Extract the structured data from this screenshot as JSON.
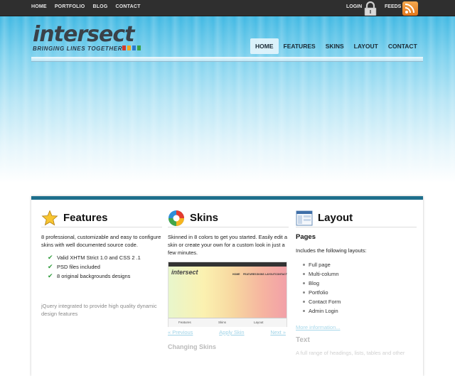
{
  "topbar": {
    "links": [
      "HOME",
      "PORTFOLIO",
      "BLOG",
      "CONTACT"
    ],
    "login": "LOGIN",
    "feeds": "FEEDS",
    "icons": {
      "login": "lock-icon",
      "feeds": "rss-icon"
    }
  },
  "header": {
    "logo": "intersect",
    "tagline": "BRINGING LINES TOGETHER",
    "nav": [
      "HOME",
      "FEATURES",
      "SKINS",
      "LAYOUT",
      "CONTACT"
    ],
    "active_nav": "HOME"
  },
  "features": {
    "title": "Features",
    "icon": "star-icon",
    "intro": "8 professional, customizable and easy to configure skins with well documented source code.",
    "checks": [
      "Valid XHTM Strict 1.0 and CSS 2 .1",
      "PSD files included",
      "8 original backgrounds designs"
    ],
    "extra": "jQuery integrated to provide high quality dynamic design features"
  },
  "skins": {
    "title": "Skins",
    "icon": "palette-icon",
    "intro": "Skinned in 8 colors to get you started. Easily edit a skin or create your own for a custom look in just a few minutes.",
    "thumb_logo": "intersect",
    "thumb_nav": [
      "HOME",
      "FEATURES",
      "SKINS",
      "LAYOUT",
      "CONTACT"
    ],
    "thumb_footer": [
      "Features",
      "Skins",
      "Layout"
    ],
    "prev": "« Previous",
    "apply": "Apply Skin",
    "next": "Next »",
    "subheading": "Changing Skins"
  },
  "layout": {
    "title": "Layout",
    "icon": "layout-window-icon",
    "pages_heading": "Pages",
    "pages_intro": "Includes the following layouts:",
    "pages": [
      "Full page",
      "Multi-column",
      "Blog",
      "Portfolio",
      "Contact Form",
      "Admin Login"
    ],
    "more_link": "More information...",
    "text_heading": "Text",
    "text_intro": "A full range of headings, lists, tables and other"
  },
  "colors": {
    "accent": "#1e6f8c",
    "logo_squares": [
      "#d23a2b",
      "#f2a31b",
      "#2b7bd0",
      "#3aa14a"
    ]
  }
}
